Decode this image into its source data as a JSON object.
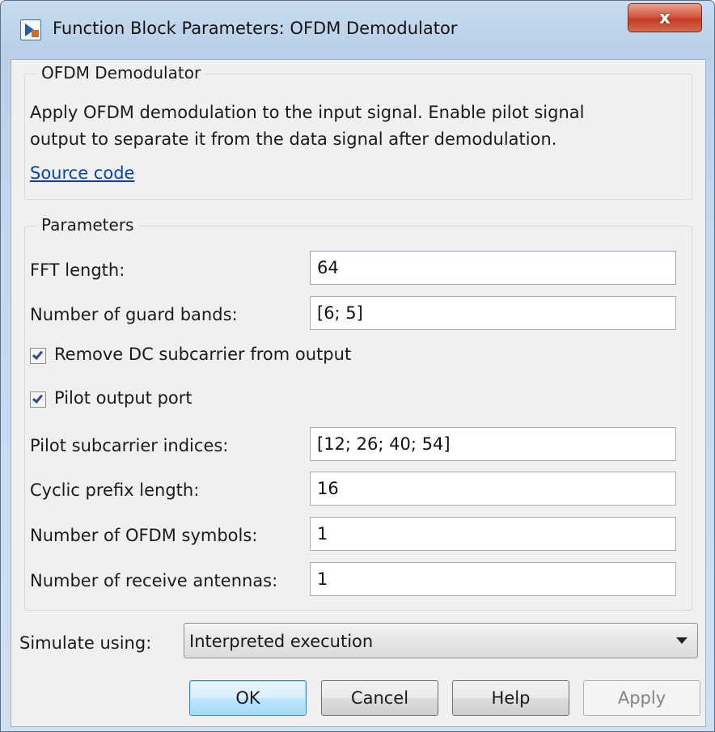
{
  "window": {
    "title": "Function Block Parameters: OFDM Demodulator",
    "close_glyph": "x"
  },
  "block_group": {
    "label": "OFDM Demodulator",
    "description": "Apply OFDM demodulation to the input signal. Enable pilot signal\noutput to separate it from the data signal after demodulation.",
    "link_text": "Source code"
  },
  "parameters": {
    "label": "Parameters",
    "fft_length": {
      "label": "FFT length:",
      "value": "64"
    },
    "guard_bands": {
      "label": "Number of guard bands:",
      "value": "[6; 5]"
    },
    "remove_dc": {
      "label": "Remove DC subcarrier from output",
      "checked": true
    },
    "pilot_port": {
      "label": "Pilot output port",
      "checked": true
    },
    "pilot_indices": {
      "label": "Pilot subcarrier indices:",
      "value": "[12; 26; 40; 54]"
    },
    "cyclic_prefix": {
      "label": "Cyclic prefix length:",
      "value": "16"
    },
    "num_symbols": {
      "label": "Number of OFDM symbols:",
      "value": "1"
    },
    "num_antennas": {
      "label": "Number of receive antennas:",
      "value": "1"
    }
  },
  "simulate": {
    "label": "Simulate using:",
    "selected": "Interpreted execution"
  },
  "buttons": {
    "ok": "OK",
    "cancel": "Cancel",
    "help": "Help",
    "apply": "Apply"
  },
  "colors": {
    "link": "#0645ad",
    "checkmark": "#2f4a85",
    "close_button": "#c23c22",
    "title_bar": "#b9d0e8"
  },
  "icons": {
    "app": "simulink-block-icon",
    "close": "close-icon",
    "dropdown": "chevron-down-icon",
    "check": "checkmark-icon"
  }
}
